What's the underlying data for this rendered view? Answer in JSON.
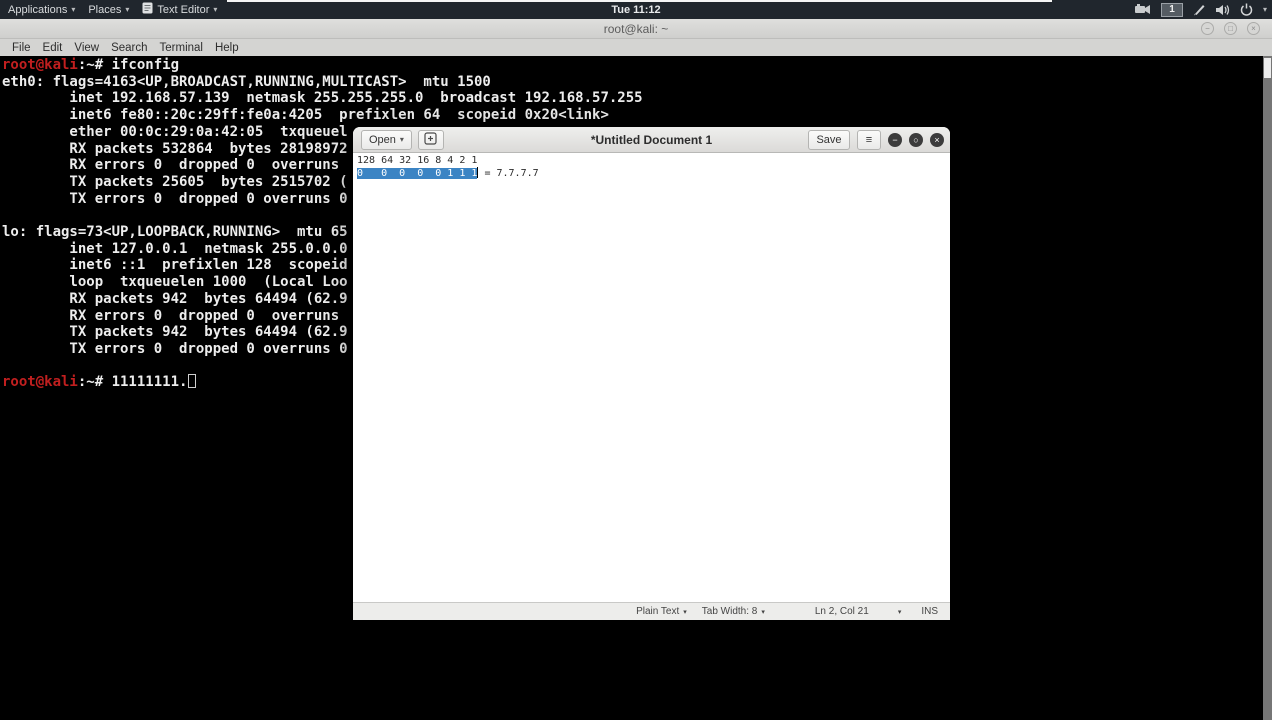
{
  "panel": {
    "menus": [
      {
        "label": "Applications",
        "icon": null
      },
      {
        "label": "Places",
        "icon": null
      },
      {
        "label": "Text Editor",
        "icon": "text-editor-icon"
      }
    ],
    "clock": "Tue 11:12",
    "workspace_indicator": "1",
    "right_icons": [
      "screen-recorder-icon",
      "workspace-indicator",
      "pen-icon",
      "volume-icon",
      "power-icon",
      "caret-down-icon"
    ]
  },
  "icons": {
    "caret_down": "▾",
    "hamburger": "≡",
    "win_minimize": "−",
    "win_maximize": "□",
    "win_close": "×",
    "circ_minimize": "−",
    "circ_maximize": "○",
    "circ_close": "×"
  },
  "terminal": {
    "title": "root@kali: ~",
    "menu": [
      "File",
      "Edit",
      "View",
      "Search",
      "Terminal",
      "Help"
    ],
    "lines": [
      [
        [
          "p",
          "root@kali"
        ],
        [
          "t",
          ":~# ifconfig"
        ]
      ],
      [
        [
          "t",
          "eth0: flags=4163<UP,BROADCAST,RUNNING,MULTICAST>  mtu 1500"
        ]
      ],
      [
        [
          "t",
          "        inet 192.168.57.139  netmask 255.255.255.0  broadcast 192.168.57.255"
        ]
      ],
      [
        [
          "t",
          "        inet6 fe80::20c:29ff:fe0a:4205  prefixlen 64  scopeid 0x20<link>"
        ]
      ],
      [
        [
          "t",
          "        ether 00:0c:29:0a:42:05  txqueuel"
        ]
      ],
      [
        [
          "t",
          "        RX packets 532864  bytes 28198972"
        ]
      ],
      [
        [
          "t",
          "        RX errors 0  dropped 0  overruns"
        ]
      ],
      [
        [
          "t",
          "        TX packets 25605  bytes 2515702 ("
        ]
      ],
      [
        [
          "t",
          "        TX errors 0  dropped 0 overruns 0"
        ]
      ],
      [
        [
          "t",
          ""
        ]
      ],
      [
        [
          "t",
          "lo: flags=73<UP,LOOPBACK,RUNNING>  mtu 65"
        ]
      ],
      [
        [
          "t",
          "        inet 127.0.0.1  netmask 255.0.0.0"
        ]
      ],
      [
        [
          "t",
          "        inet6 ::1  prefixlen 128  scopeid"
        ]
      ],
      [
        [
          "t",
          "        loop  txqueuelen 1000  (Local Loo"
        ]
      ],
      [
        [
          "t",
          "        RX packets 942  bytes 64494 (62.9"
        ]
      ],
      [
        [
          "t",
          "        RX errors 0  dropped 0  overruns"
        ]
      ],
      [
        [
          "t",
          "        TX packets 942  bytes 64494 (62.9"
        ]
      ],
      [
        [
          "t",
          "        TX errors 0  dropped 0 overruns 0"
        ]
      ],
      [
        [
          "t",
          ""
        ]
      ],
      [
        [
          "p",
          "root@kali"
        ],
        [
          "t",
          ":~# 11111111."
        ],
        [
          "c",
          ""
        ]
      ]
    ]
  },
  "gedit": {
    "open_label": "Open",
    "title": "*Untitled Document 1",
    "save_label": "Save",
    "content": {
      "line1": "128 64 32 16 8 4 2 1",
      "line2_selected": "0   0  0  0  0 1 1 1",
      "line2_rest": " = 7.7.7.7"
    },
    "statusbar": {
      "language": "Plain Text",
      "tab_width": "Tab Width: 8",
      "position": "Ln 2, Col 21",
      "mode": "INS"
    }
  },
  "colors": {
    "panel_bg": "#20262d",
    "terminal_bg": "#000000",
    "prompt_red": "#c11f1f",
    "selection_blue": "#3b84c4",
    "headerbar_gray": "#e3e2e0"
  }
}
